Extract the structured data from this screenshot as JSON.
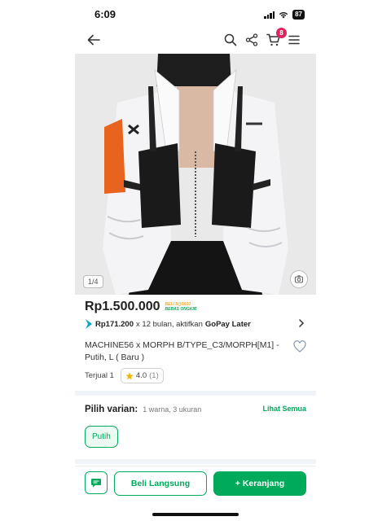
{
  "status_bar": {
    "time": "6:09",
    "battery": "87"
  },
  "nav": {
    "cart_count": "8"
  },
  "gallery": {
    "counter": "1/4"
  },
  "product": {
    "price": "Rp1.500.000",
    "shipping_badge_top": "BELI 8@5010",
    "shipping_badge_bottom": "BEBAS ONGKIR",
    "paylater_amount": "Rp171.200",
    "paylater_text": "x 12 bulan, aktifkan",
    "paylater_brand": "GoPay Later",
    "title": "MACHINE56 x MORPH B/TYPE_C3/MORPH[M1] - Putih, L ( Baru )",
    "sold": "Terjual 1",
    "rating": "4.0",
    "rating_count": "(1)"
  },
  "variants": {
    "label": "Pilih varian:",
    "summary": "1 warna, 3 ukuran",
    "see_all": "Lihat Semua",
    "options": [
      "Putih"
    ]
  },
  "actions": {
    "buy_now": "Beli Langsung",
    "add_to_cart": "+ Keranjang"
  },
  "colors": {
    "brand_green": "#00aa5b",
    "badge_red": "#e0245e",
    "star": "#f5b400"
  }
}
